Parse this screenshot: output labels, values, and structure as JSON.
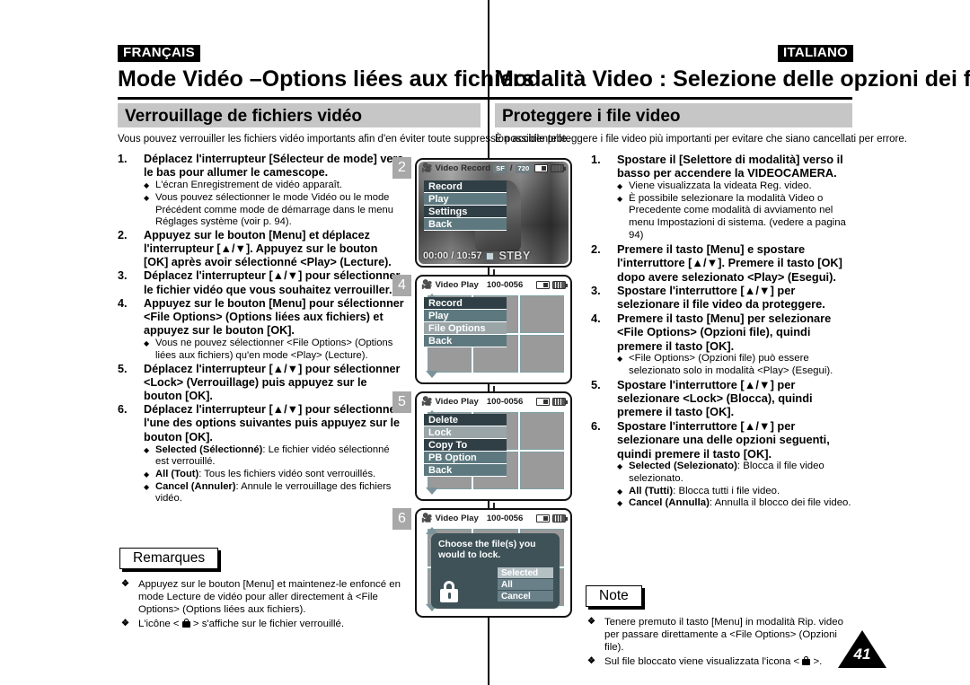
{
  "document": {
    "page_number": "41",
    "divider": true
  },
  "left": {
    "language_tag": "FRANÇAIS",
    "chapter_title": "Mode Vidéo –Options liées aux fichiers",
    "section_title": "Verrouillage de fichiers vidéo",
    "intro": "Vous pouvez verrouiller les fichiers vidéo importants afin d'en éviter toute suppression accidentelle.",
    "steps": [
      {
        "num": "1.",
        "text": "Déplacez l'interrupteur [Sélecteur de mode] vers le bas pour allumer le camescope.",
        "bullets": [
          "L'écran Enregistrement de vidéo apparaît.",
          "Vous pouvez sélectionner le mode Vidéo ou le mode Précédent comme mode de démarrage dans le menu Réglages système (voir p. 94)."
        ]
      },
      {
        "num": "2.",
        "text": "Appuyez sur le bouton [Menu] et déplacez l'interrupteur [▲/▼]. Appuyez sur le bouton [OK] après avoir sélectionné <Play> (Lecture).",
        "bullets": []
      },
      {
        "num": "3.",
        "text": "Déplacez l'interrupteur [▲/▼] pour sélectionner le fichier vidéo que vous souhaitez verrouiller.",
        "bullets": []
      },
      {
        "num": "4.",
        "text": "Appuyez sur le bouton [Menu] pour sélectionner <File Options> (Options liées aux fichiers) et appuyez sur le bouton [OK].",
        "bullets": [
          "Vous ne pouvez sélectionner <File Options> (Options liées aux fichiers) qu'en mode <Play> (Lecture)."
        ]
      },
      {
        "num": "5.",
        "text": "Déplacez l'interrupteur [▲/▼] pour sélectionner <Lock> (Verrouillage) puis appuyez sur le bouton [OK].",
        "bullets": []
      },
      {
        "num": "6.",
        "text": "Déplacez l'interrupteur [▲/▼] pour sélectionner l'une des options suivantes puis appuyez sur le bouton [OK].",
        "bullets": [
          "Selected (Sélectionné): Le fichier vidéo sélectionné est verrouillé.",
          "All (Tout): Tous les fichiers vidéo sont verrouillés.",
          "Cancel (Annuler): Annule le verrouillage des fichiers vidéo."
        ],
        "bullet_bold_prefix": [
          "Selected (Sélectionné)",
          "All (Tout)",
          "Cancel (Annuler)"
        ]
      }
    ],
    "note_box_label": "Remarques",
    "notes": [
      "Appuyez sur le bouton [Menu] et maintenez-le enfoncé en mode Lecture de vidéo pour aller directement à <File Options> (Options liées aux fichiers).",
      "L'icône < 🔒 > s'affiche sur le fichier verrouillé."
    ],
    "note_2_prefix": "L'icône <",
    "note_2_suffix": "> s'affiche sur le fichier verrouillé."
  },
  "right": {
    "language_tag": "ITALIANO",
    "chapter_title": "Modalità Video : Selezione delle opzioni dei file",
    "section_title": "Proteggere i file video",
    "intro": "È possibile proteggere i file video più importanti per evitare che siano cancellati per errore.",
    "steps": [
      {
        "num": "1.",
        "text": "Spostare il [Selettore di modalità] verso il basso per accendere la VIDEOCAMERA.",
        "bullets": [
          "Viene visualizzata la videata Reg. video.",
          "È possibile selezionare la modalità Video  o Precedente come modalità di avviamento nel menu Impostazioni di sistema. (vedere a pagina 94)"
        ]
      },
      {
        "num": "2.",
        "text": "Premere il tasto [Menu] e spostare l'interruttore [▲/▼]. Premere il tasto [OK] dopo avere selezionato <Play> (Esegui).",
        "bullets": []
      },
      {
        "num": "3.",
        "text": "Spostare l'interruttore [▲/▼] per selezionare il file video da proteggere.",
        "bullets": []
      },
      {
        "num": "4.",
        "text": "Premere il tasto [Menu] per selezionare <File Options> (Opzioni file), quindi premere il tasto [OK].",
        "bullets": [
          "<File Options> (Opzioni file) può essere selezionato solo in modalità <Play> (Esegui)."
        ]
      },
      {
        "num": "5.",
        "text": "Spostare l'interruttore [▲/▼] per selezionare <Lock> (Blocca), quindi premere il tasto [OK].",
        "bullets": []
      },
      {
        "num": "6.",
        "text": "Spostare l'interruttore [▲/▼] per selezionare una delle opzioni seguenti, quindi premere il tasto [OK].",
        "bullets": [
          "Selected (Selezionato): Blocca il file video selezionato.",
          "All (Tutti): Blocca tutti i file video.",
          "Cancel (Annulla): Annulla il blocco dei file video."
        ],
        "bullet_bold_prefix": [
          "Selected (Selezionato)",
          "All (Tutti)",
          "Cancel (Annulla)"
        ]
      }
    ],
    "note_box_label": "Note",
    "notes": [
      "Tenere premuto il tasto [Menu] in modalità Rip. video per passare direttamente a <File Options> (Opzioni file).",
      "Sul file bloccato viene visualizzata l'icona < 🔒 >."
    ],
    "note_2_prefix": "Sul file bloccato viene visualizzata l'icona <",
    "note_2_suffix": ">."
  },
  "screens": [
    {
      "step_marker": "2",
      "title": "Video Record",
      "chips": [
        "SF",
        "/",
        "720"
      ],
      "menu": [
        {
          "label": "Record",
          "style": "dark"
        },
        {
          "label": "Play",
          "style": "teal"
        },
        {
          "label": "Settings",
          "style": "dark"
        },
        {
          "label": "Back",
          "style": "teal"
        }
      ],
      "timecode": "00:00 / 10:57",
      "status": "STBY"
    },
    {
      "step_marker": "4",
      "title": "Video Play",
      "file_number": "100-0056",
      "menu": [
        {
          "label": "Record",
          "style": "dark"
        },
        {
          "label": "Play",
          "style": "teal"
        },
        {
          "label": "File Options",
          "style": "grey"
        },
        {
          "label": "Back",
          "style": "teal"
        }
      ]
    },
    {
      "step_marker": "5",
      "title": "Video Play",
      "file_number": "100-0056",
      "menu": [
        {
          "label": "Delete",
          "style": "dark"
        },
        {
          "label": "Lock",
          "style": "grey"
        },
        {
          "label": "Copy To",
          "style": "dark"
        },
        {
          "label": "PB Option",
          "style": "teal"
        },
        {
          "label": "Back",
          "style": "teal"
        }
      ]
    },
    {
      "step_marker": "6",
      "title": "Video Play",
      "file_number": "100-0056",
      "dialog": {
        "message": "Choose the file(s) you would to lock.",
        "options": [
          {
            "label": "Selected",
            "selected": true
          },
          {
            "label": "All",
            "selected": false
          },
          {
            "label": "Cancel",
            "selected": false
          }
        ]
      }
    }
  ]
}
